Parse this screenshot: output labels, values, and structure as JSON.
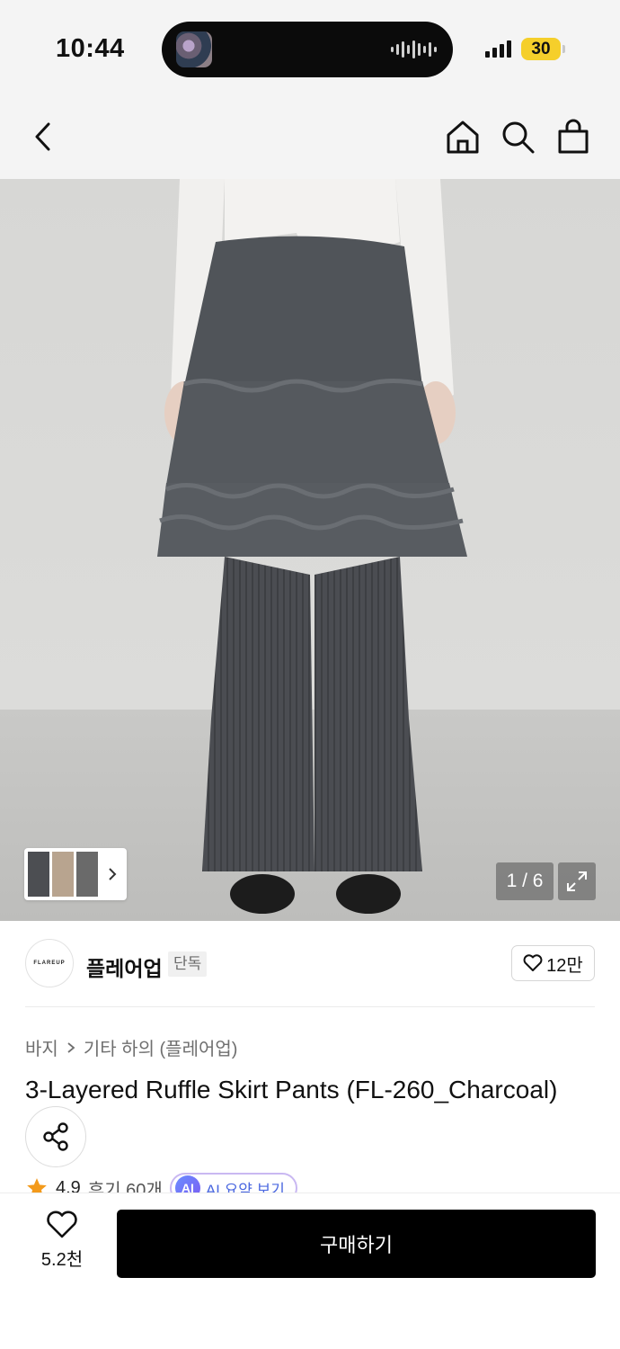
{
  "status_bar": {
    "time": "10:44",
    "battery": "30",
    "battery_color": "#f5cf2b"
  },
  "nav": {
    "back_icon": "chevron-left-icon",
    "home_icon": "home-icon",
    "search_icon": "search-icon",
    "bag_icon": "shopping-bag-icon"
  },
  "gallery": {
    "counter": "1 / 6",
    "expand_icon": "expand-icon"
  },
  "brand": {
    "logo_text": "FLAREUP",
    "name": "플레어업",
    "badge": "단독",
    "likes": "12만"
  },
  "breadcrumb": {
    "category": "바지",
    "subcategory": "기타 하의 (플레어업)"
  },
  "product": {
    "title": "3-Layered Ruffle Skirt Pants (FL-260_Charcoal)"
  },
  "rating": {
    "score": "4.9",
    "reviews": "후기 60개",
    "ai_badge": "AI",
    "ai_label": "AI 요약 보기"
  },
  "bottom_bar": {
    "wish_count": "5.2천",
    "buy_label": "구매하기",
    "buy_color": "#000000"
  }
}
